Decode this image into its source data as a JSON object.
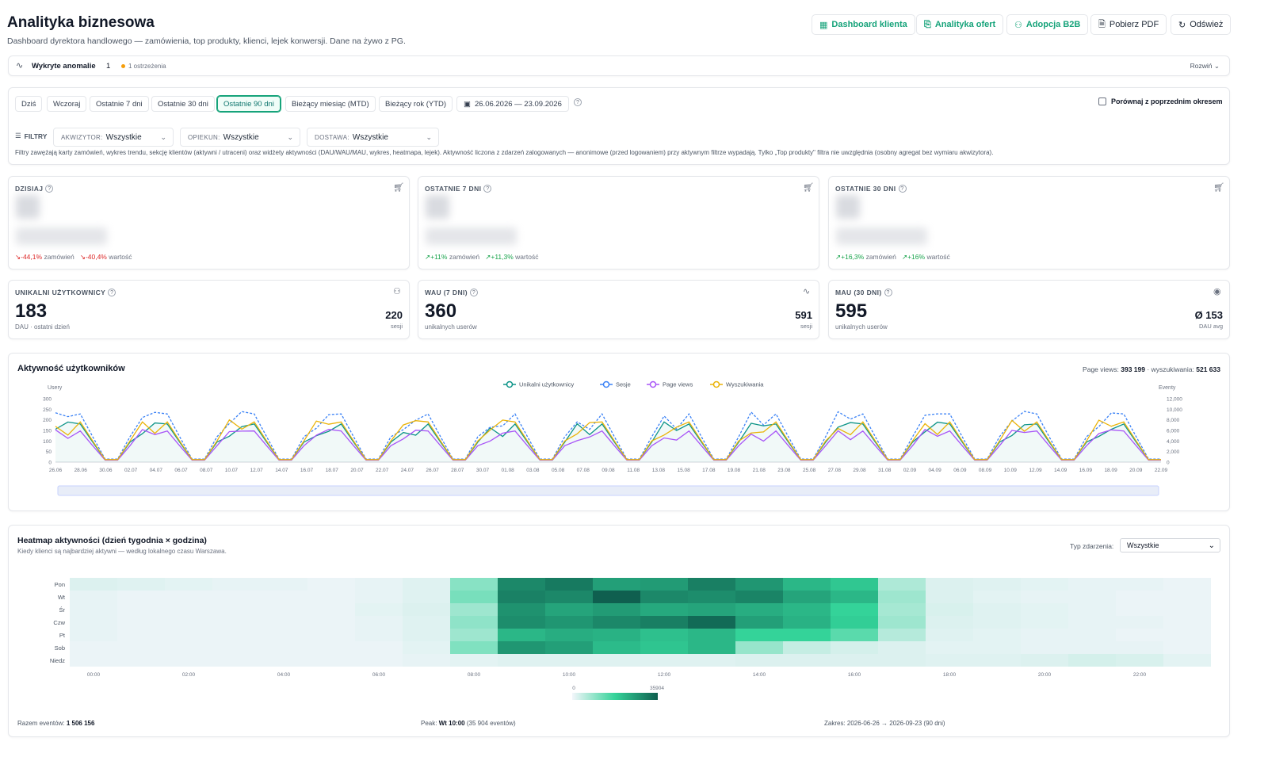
{
  "header": {
    "title": "Analityka biznesowa",
    "subtitle": "Dashboard dyrektora handlowego — zamówienia, top produkty, klienci, lejek konwersji. Dane na żywo z PG.",
    "buttons": {
      "dashboard": "Dashboard klienta",
      "oferty": "Analityka ofert",
      "adopcja": "Adopcja B2B",
      "pdf": "Pobierz PDF",
      "refresh": "Odśwież"
    }
  },
  "anomalies": {
    "label": "Wykryte anomalie",
    "count": "1",
    "warnings": "1 ostrzeżenia",
    "expand": "Rozwiń"
  },
  "range": {
    "chips": [
      "Dziś",
      "Wczoraj",
      "Ostatnie 7 dni",
      "Ostatnie 30 dni",
      "Ostatnie 90 dni",
      "Bieżący miesiąc (MTD)",
      "Bieżący rok (YTD)"
    ],
    "active": "Ostatnie 90 dni",
    "dates": "26.06.2026 — 23.09.2026",
    "compare": "Porównaj z poprzednim okresem"
  },
  "filters": {
    "label": "FILTRY",
    "akwizytor_k": "AKWIZYTOR:",
    "akwizytor_v": "Wszystkie",
    "opiekun_k": "OPIEKUN:",
    "opiekun_v": "Wszystkie",
    "dostawa_k": "DOSTAWA:",
    "dostawa_v": "Wszystkie",
    "note": "Filtry zawężają karty zamówień, wykres trendu, sekcję klientów (aktywni / utraceni) oraz widżety aktywności (DAU/WAU/MAU, wykres, heatmapa, lejek). Aktywność liczona z zdarzeń zalogowanych — anonimowe (przed logowaniem) przy aktywnym filtrze wypadają. Tylko „Top produkty\" filtra nie uwzględnia (osobny agregat bez wymiaru akwizytora)."
  },
  "orders": [
    {
      "title": "DZISIAJ",
      "t1": "-44,1%",
      "t1l": "zamówień",
      "t2": "-40,4%",
      "t2l": "wartość",
      "dir": "down"
    },
    {
      "title": "OSTATNIE 7 DNI",
      "t1": "+11%",
      "t1l": "zamówień",
      "t2": "+11,3%",
      "t2l": "wartość",
      "dir": "up"
    },
    {
      "title": "OSTATNIE 30 DNI",
      "t1": "+16,3%",
      "t1l": "zamówień",
      "t2": "+16%",
      "t2l": "wartość",
      "dir": "up"
    }
  ],
  "users": [
    {
      "title": "UNIKALNI UŻYTKOWNICY",
      "value": "183",
      "sub": "DAU · ostatni dzień",
      "rv": "220",
      "rs": "sesji"
    },
    {
      "title": "WAU (7 DNI)",
      "value": "360",
      "sub": "unikalnych userów",
      "rv": "591",
      "rs": "sesji"
    },
    {
      "title": "MAU (30 DNI)",
      "value": "595",
      "sub": "unikalnych userów",
      "rv": "Ø 153",
      "rs": "DAU avg"
    }
  ],
  "activity": {
    "title": "Aktywność użytkowników",
    "pv_label": "Page views:",
    "pv": "393 199",
    "search_label": "wyszukiwania:",
    "search": "521 633",
    "yleft": "Usery",
    "yright": "Eventy"
  },
  "chart_data": {
    "type": "line",
    "title": "Aktywność użytkowników",
    "x": [
      "26.06",
      "28.06",
      "30.06",
      "02.07",
      "04.07",
      "06.07",
      "08.07",
      "10.07",
      "12.07",
      "14.07",
      "16.07",
      "18.07",
      "20.07",
      "22.07",
      "24.07",
      "26.07",
      "28.07",
      "30.07",
      "01.08",
      "03.08",
      "05.08",
      "07.08",
      "09.08",
      "11.08",
      "13.08",
      "15.08",
      "17.08",
      "19.08",
      "21.08",
      "23.08",
      "25.08",
      "27.08",
      "29.08",
      "31.08",
      "02.09",
      "04.09",
      "06.09",
      "08.09",
      "10.09",
      "12.09",
      "14.09",
      "16.09",
      "18.09",
      "20.09",
      "22.09"
    ],
    "ylim": [
      0,
      300
    ],
    "y2lim": [
      0,
      12000
    ],
    "yticks": [
      0,
      50,
      100,
      150,
      200,
      250,
      300
    ],
    "y2ticks": [
      "0",
      "2,000",
      "4,000",
      "6,000",
      "8,000",
      "10,000",
      "12,000"
    ],
    "legend": "top-center",
    "series": [
      {
        "name": "Unikalni użytkownicy",
        "color": "#0d9488",
        "axis": "left",
        "base": 190
      },
      {
        "name": "Sesje",
        "color": "#3b82f6",
        "axis": "left",
        "base": 240
      },
      {
        "name": "Page views",
        "color": "#a855f7",
        "axis": "right",
        "base": 6200
      },
      {
        "name": "Wyszukiwania",
        "color": "#eab308",
        "axis": "right",
        "base": 8000
      }
    ]
  },
  "heatmap": {
    "title": "Heatmap aktywności (dzień tygodnia × godzina)",
    "subtitle": "Kiedy klienci są najbardziej aktywni — według lokalnego czasu Warszawa.",
    "type_label": "Typ zdarzenia:",
    "type_value": "Wszystkie",
    "days": [
      "Pon",
      "Wt",
      "Śr",
      "Czw",
      "Pt",
      "Sob",
      "Niedz"
    ],
    "hours": [
      "00:00",
      "02:00",
      "04:00",
      "06:00",
      "08:00",
      "10:00",
      "12:00",
      "14:00",
      "16:00",
      "18:00",
      "20:00",
      "22:00"
    ],
    "scale_min": "0",
    "scale_max": "35904",
    "total_label": "Razem eventów:",
    "total": "1 506 156",
    "peak_label": "Peak:",
    "peak": "Wt 10:00",
    "peak_note": "(35 904 eventów)",
    "range": "Zakres: 2026-06-26 → 2026-09-23 (90 dni)",
    "values": [
      [
        0.06,
        0.05,
        0.04,
        0.03,
        0.03,
        0.02,
        0.03,
        0.05,
        0.28,
        0.82,
        0.88,
        0.72,
        0.74,
        0.86,
        0.76,
        0.62,
        0.55,
        0.18,
        0.06,
        0.05,
        0.04,
        0.03,
        0.03,
        0.02
      ],
      [
        0.03,
        0.02,
        0.02,
        0.02,
        0.02,
        0.02,
        0.03,
        0.05,
        0.32,
        0.85,
        0.82,
        1.0,
        0.82,
        0.8,
        0.84,
        0.7,
        0.62,
        0.22,
        0.06,
        0.04,
        0.03,
        0.03,
        0.02,
        0.02
      ],
      [
        0.03,
        0.02,
        0.02,
        0.02,
        0.02,
        0.02,
        0.04,
        0.06,
        0.22,
        0.78,
        0.7,
        0.74,
        0.68,
        0.7,
        0.66,
        0.62,
        0.5,
        0.2,
        0.07,
        0.05,
        0.04,
        0.03,
        0.02,
        0.02
      ],
      [
        0.03,
        0.02,
        0.02,
        0.02,
        0.02,
        0.02,
        0.03,
        0.05,
        0.26,
        0.8,
        0.76,
        0.82,
        0.86,
        0.95,
        0.72,
        0.64,
        0.52,
        0.22,
        0.06,
        0.05,
        0.04,
        0.03,
        0.03,
        0.02
      ],
      [
        0.03,
        0.02,
        0.02,
        0.02,
        0.02,
        0.02,
        0.03,
        0.05,
        0.22,
        0.62,
        0.66,
        0.64,
        0.58,
        0.62,
        0.5,
        0.5,
        0.4,
        0.16,
        0.05,
        0.04,
        0.03,
        0.03,
        0.02,
        0.02
      ],
      [
        0.02,
        0.02,
        0.02,
        0.02,
        0.02,
        0.02,
        0.02,
        0.04,
        0.3,
        0.76,
        0.72,
        0.6,
        0.56,
        0.62,
        0.24,
        0.12,
        0.08,
        0.06,
        0.04,
        0.04,
        0.03,
        0.03,
        0.03,
        0.02
      ],
      [
        0.02,
        0.02,
        0.02,
        0.02,
        0.02,
        0.02,
        0.02,
        0.03,
        0.04,
        0.05,
        0.05,
        0.05,
        0.05,
        0.05,
        0.06,
        0.06,
        0.06,
        0.06,
        0.05,
        0.05,
        0.06,
        0.08,
        0.07,
        0.04
      ]
    ]
  }
}
